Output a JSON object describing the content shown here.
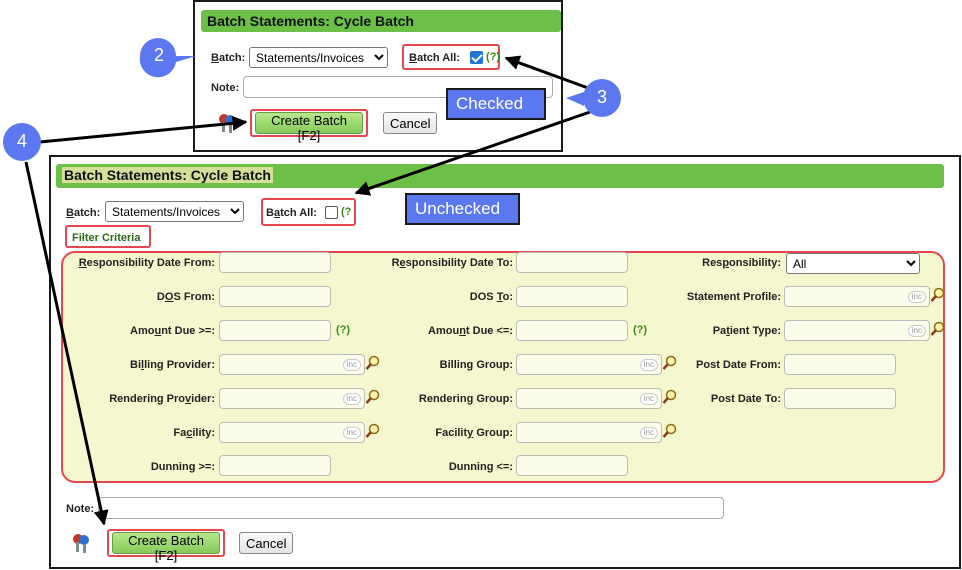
{
  "panel_top": {
    "title": "Batch Statements: Cycle Batch",
    "batch_label": "Batch:",
    "batch_value": "Statements/Invoices",
    "batch_all_label": "Batch All:",
    "help": "(?)",
    "note_label": "Note:",
    "create_button": "Create Batch [F2]",
    "cancel_button": "Cancel"
  },
  "panel_bottom": {
    "title": "Batch Statements: Cycle Batch",
    "batch_label": "Batch:",
    "batch_value": "Statements/Invoices",
    "batch_all_label": "Batch All:",
    "help": "(?",
    "filter_criteria": "Filter Criteria",
    "fields": {
      "resp_date_from": "Responsibility Date From:",
      "resp_date_to": "Responsibility Date To:",
      "responsibility": "Responsibility:",
      "responsibility_value": "All",
      "dos_from": "DOS From:",
      "dos_to": "DOS To:",
      "statement_profile": "Statement Profile:",
      "amount_due_ge": "Amount Due >=:",
      "amount_due_le": "Amount Due <=:",
      "patient_type": "Patient Type:",
      "billing_provider": "Billing Provider:",
      "billing_group": "Billing Group:",
      "post_date_from": "Post Date From:",
      "rendering_provider": "Rendering Provider:",
      "rendering_group": "Rendering Group:",
      "post_date_to": "Post Date To:",
      "facility": "Facility:",
      "facility_group": "Facility Group:",
      "dunning_ge": "Dunning >=:",
      "dunning_le": "Dunning <=:"
    },
    "inc": "inc",
    "help_q": "(?)",
    "note_label": "Note:",
    "create_button": "Create Batch [F2]",
    "cancel_button": "Cancel"
  },
  "annotations": {
    "step2": "2",
    "step3": "3",
    "step4": "4",
    "checked": "Checked",
    "unchecked": "Unchecked"
  },
  "colors": {
    "title_green": "#6cc048",
    "highlight_red": "#e5474f",
    "callout_blue": "#5b78f0",
    "filter_bg": "#f5f7cf"
  }
}
